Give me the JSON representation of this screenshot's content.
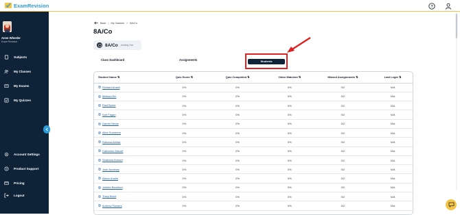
{
  "app": {
    "logo_text": "ExamRevision"
  },
  "user": {
    "name": "Anne Wheeler",
    "subtitle": "Exam Revision"
  },
  "sidebar": {
    "primary": [
      {
        "label": "Subjects",
        "icon": "book-icon"
      },
      {
        "label": "My Classes",
        "icon": "people-icon"
      },
      {
        "label": "My Exams",
        "icon": "exam-icon"
      },
      {
        "label": "My Quizzes",
        "icon": "quiz-check-icon"
      }
    ],
    "secondary": [
      {
        "label": "Account Settings",
        "icon": "gear-icon"
      },
      {
        "label": "Product Support",
        "icon": "help-icon"
      },
      {
        "label": "Pricing",
        "icon": "card-icon"
      },
      {
        "label": "Logout",
        "icon": "logout-icon"
      }
    ]
  },
  "breadcrumb": {
    "back": "Back",
    "sep1": "|",
    "item1": "My Classes",
    "sep2": ">",
    "item2": "8A/Co"
  },
  "page": {
    "title": "8A/Co"
  },
  "class_chip": {
    "name": "8A/Co",
    "sub": "Leading Cert"
  },
  "tabs": {
    "dashboard": "Class Dashboard",
    "assignments": "Assignments",
    "students": "Students"
  },
  "table": {
    "headers": {
      "name": "Student Name ⇅",
      "quiz_score": "Quiz Score ⇅",
      "quiz_completed": "Quiz Completed ⇅",
      "video_watched": "Video Watched ⇅",
      "missed": "Missed Assignments ⇅",
      "last_login": "Last Login ⇅"
    },
    "rows": [
      {
        "name": "Richard Ansell",
        "quiz_score": "0%",
        "quiz_completed": "0%",
        "video_watched": "0%",
        "missed": "0/2",
        "last_login": "N/A"
      },
      {
        "name": "Melissa Ein",
        "quiz_score": "0%",
        "quiz_completed": "0%",
        "video_watched": "0%",
        "missed": "0/2",
        "last_login": "N/A"
      },
      {
        "name": "Paul Byrne",
        "quiz_score": "0%",
        "quiz_completed": "0%",
        "video_watched": "0%",
        "missed": "0/2",
        "last_login": "N/A"
      },
      {
        "name": "Karl Fagan",
        "quiz_score": "0%",
        "quiz_completed": "0%",
        "video_watched": "0%",
        "missed": "0/2",
        "last_login": "N/A"
      },
      {
        "name": "Darren Hinde",
        "quiz_score": "0%",
        "quiz_completed": "0%",
        "video_watched": "0%",
        "missed": "0/2",
        "last_login": "N/A"
      },
      {
        "name": "Alice Summers",
        "quiz_score": "0%",
        "quiz_completed": "0%",
        "video_watched": "0%",
        "missed": "0/2",
        "last_login": "N/A"
      },
      {
        "name": "Rahana Akhtar",
        "quiz_score": "0%",
        "quiz_completed": "0%",
        "video_watched": "0%",
        "missed": "0/2",
        "last_login": "N/A"
      },
      {
        "name": "Catherine Allcroft",
        "quiz_score": "0%",
        "quiz_completed": "0%",
        "video_watched": "0%",
        "missed": "0/2",
        "last_login": "N/A"
      },
      {
        "name": "Shabana Amrani",
        "quiz_score": "0%",
        "quiz_completed": "0%",
        "video_watched": "0%",
        "missed": "0/2",
        "last_login": "N/A"
      },
      {
        "name": "Josh Andrews",
        "quiz_score": "0%",
        "quiz_completed": "0%",
        "video_watched": "0%",
        "missed": "0/2",
        "last_login": "N/A"
      },
      {
        "name": "Alison Austin",
        "quiz_score": "0%",
        "quiz_completed": "0%",
        "video_watched": "0%",
        "missed": "0/2",
        "last_login": "N/A"
      },
      {
        "name": "Juliette Beckford",
        "quiz_score": "0%",
        "quiz_completed": "0%",
        "video_watched": "0%",
        "missed": "0/2",
        "last_login": "N/A"
      },
      {
        "name": "Tracy Bond",
        "quiz_score": "0%",
        "quiz_completed": "0%",
        "video_watched": "0%",
        "missed": "0/2",
        "last_login": "N/A"
      },
      {
        "name": "Andrew Flowers",
        "quiz_score": "0%",
        "quiz_completed": "0%",
        "video_watched": "0%",
        "missed": "0/2",
        "last_login": "N/A"
      }
    ]
  },
  "colors": {
    "sidebar_bg": "#0e2238",
    "accent": "#2a9bd7",
    "highlight": "#e02020",
    "link": "#1d5fa8",
    "chat": "#f4c542"
  }
}
